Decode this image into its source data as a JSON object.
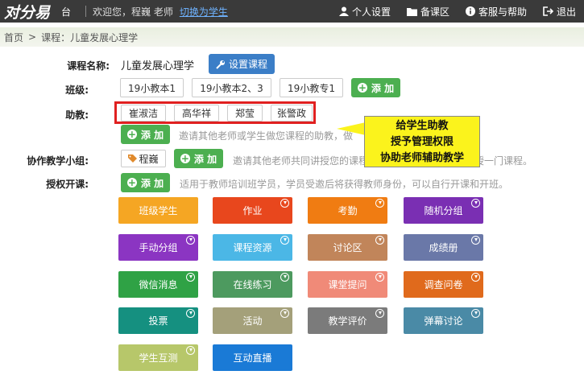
{
  "topbar": {
    "logo": "对分易",
    "tai": "台",
    "welcome": "欢迎您，程巍 老师",
    "switch_label": "切换为学生",
    "nav": [
      {
        "label": "个人设置",
        "icon": "user-icon"
      },
      {
        "label": "备课区",
        "icon": "folder-icon"
      },
      {
        "label": "客服与帮助",
        "icon": "info-icon"
      },
      {
        "label": "退出",
        "icon": "logout-icon"
      }
    ]
  },
  "breadcrumb": {
    "home": "首页",
    "separator": ">",
    "current": "课程：儿童发展心理学"
  },
  "form": {
    "course_label": "课程名称:",
    "course_name": "儿童发展心理学",
    "course_settings_label": "设置课程",
    "class_label": "班级:",
    "classes": [
      "19小教本1",
      "19小教本2、3",
      "19小教专1"
    ],
    "add_label": "添 加",
    "assistant_label": "助教:",
    "assistants": [
      "崔淑洁",
      "高华祥",
      "郑莹",
      "张警政"
    ],
    "assistant_hint": "邀请其他老师或学生做您课程的助教，做",
    "team_label": "协作教学小组:",
    "team_member": "程巍",
    "team_hint": "邀请其他老师共同讲授您的课程，或者和其他老师共同讲授一门课程。",
    "license_label": "授权开课:",
    "license_hint": "适用于教师培训班学员，学员受邀后将获得教师身份，可以自行开课和开班。"
  },
  "callout": {
    "lines": [
      "给学生助教",
      "授予管理权限",
      "协助老师辅助教学"
    ]
  },
  "tiles": [
    {
      "label": "班级学生",
      "color": "#f5a623",
      "download": false
    },
    {
      "label": "作业",
      "color": "#e8471d",
      "download": true
    },
    {
      "label": "考勤",
      "color": "#f07c12",
      "download": true
    },
    {
      "label": "随机分组",
      "color": "#7a2fb3",
      "download": true
    },
    {
      "label": "手动分组",
      "color": "#8b35c2",
      "download": true
    },
    {
      "label": "课程资源",
      "color": "#4bb7e6",
      "download": true
    },
    {
      "label": "讨论区",
      "color": "#c1855a",
      "download": true
    },
    {
      "label": "成绩册",
      "color": "#6a78a8",
      "download": true
    },
    {
      "label": "微信消息",
      "color": "#2fa245",
      "download": true
    },
    {
      "label": "在线练习",
      "color": "#4d9a5f",
      "download": true
    },
    {
      "label": "课堂提问",
      "color": "#f08a78",
      "download": true
    },
    {
      "label": "调查问卷",
      "color": "#e06a1c",
      "download": true
    },
    {
      "label": "投票",
      "color": "#159080",
      "download": true
    },
    {
      "label": "活动",
      "color": "#a4a07a",
      "download": true
    },
    {
      "label": "教学评价",
      "color": "#7b7b7b",
      "download": true
    },
    {
      "label": "弹幕讨论",
      "color": "#4a8aa6",
      "download": true
    },
    {
      "label": "学生互测",
      "color": "#b7c76a",
      "download": true
    },
    {
      "label": "互动直播",
      "color": "#1a7ad6",
      "download": false
    }
  ]
}
